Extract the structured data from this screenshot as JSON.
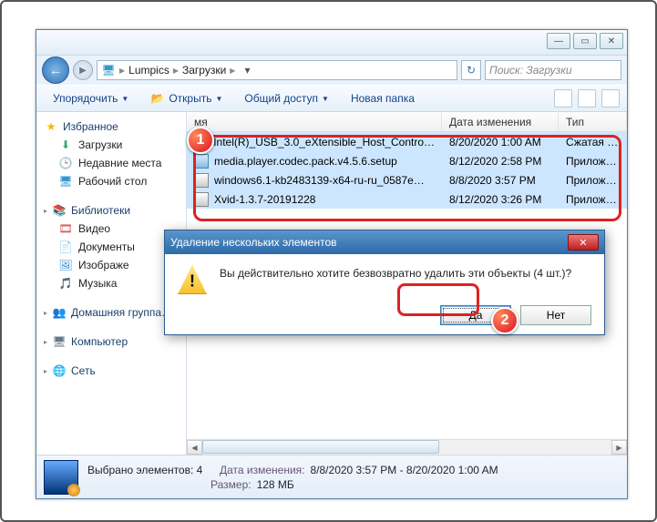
{
  "breadcrumb": {
    "root_icon": "computer-icon",
    "seg1": "Lumpics",
    "seg2": "Загрузки"
  },
  "search": {
    "placeholder": "Поиск: Загрузки"
  },
  "toolbar": {
    "organize": "Упорядочить",
    "open": "Открыть",
    "share": "Общий доступ",
    "new_folder": "Новая папка"
  },
  "sidebar": {
    "favorites": {
      "label": "Избранное",
      "items": [
        {
          "label": "Загрузки"
        },
        {
          "label": "Недавние места"
        },
        {
          "label": "Рабочий стол"
        }
      ]
    },
    "libraries": {
      "label": "Библиотеки",
      "items": [
        {
          "label": "Видео"
        },
        {
          "label": "Документы"
        },
        {
          "label": "Изображе"
        },
        {
          "label": "Музыка"
        }
      ]
    },
    "homegroup": {
      "label": "Домашняя группа…"
    },
    "computer": {
      "label": "Компьютер"
    },
    "network": {
      "label": "Сеть"
    }
  },
  "columns": {
    "name": "мя",
    "date": "Дата изменения",
    "type": "Тип"
  },
  "files": [
    {
      "icon": "zip",
      "name": "Intel(R)_USB_3.0_eXtensible_Host_Contro…",
      "date": "8/20/2020 1:00 AM",
      "type": "Сжатая ZIP-па"
    },
    {
      "icon": "exe",
      "name": "media.player.codec.pack.v4.5.6.setup",
      "date": "8/12/2020 2:58 PM",
      "type": "Приложение"
    },
    {
      "icon": "exe2",
      "name": "windows6.1-kb2483139-x64-ru-ru_0587e…",
      "date": "8/8/2020 3:57 PM",
      "type": "Приложение"
    },
    {
      "icon": "exe2",
      "name": "Xvid-1.3.7-20191228",
      "date": "8/12/2020 3:26 PM",
      "type": "Приложение"
    }
  ],
  "dialog": {
    "title": "Удаление нескольких элементов",
    "message": "Вы действительно хотите безвозвратно удалить эти объекты (4 шт.)?",
    "yes": "Да",
    "no": "Нет"
  },
  "details": {
    "title": "Выбрано элементов: 4",
    "date_label": "Дата изменения:",
    "date_val": "8/8/2020 3:57 PM - 8/20/2020 1:00 AM",
    "size_label": "Размер:",
    "size_val": "128 МБ"
  },
  "badges": {
    "one": "1",
    "two": "2"
  }
}
